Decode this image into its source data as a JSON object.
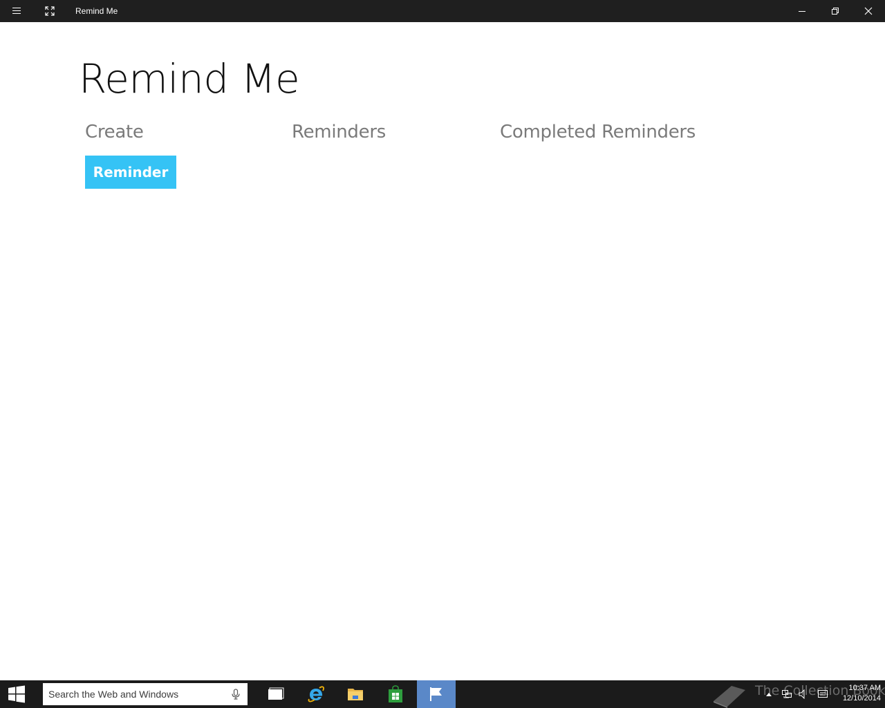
{
  "window": {
    "title": "Remind Me",
    "controls": {
      "menu_icon": "hamburger-icon",
      "fullscreen_icon": "fullscreen-icon",
      "minimize_icon": "minimize-icon",
      "maximize_icon": "restore-icon",
      "close_icon": "close-icon"
    }
  },
  "app": {
    "title": "Remind Me",
    "sections": {
      "create": "Create",
      "reminders": "Reminders",
      "completed": "Completed Reminders"
    },
    "reminder_button_label": "Reminder",
    "accent_color": "#35c3f5"
  },
  "taskbar": {
    "search_placeholder": "Search the Web and Windows",
    "apps": [
      "task-view-icon",
      "internet-explorer-icon",
      "file-explorer-icon",
      "store-icon",
      "remind-me-icon"
    ],
    "watermark": "The Collection Book",
    "time": "10:37 AM",
    "date": "12/10/2014"
  }
}
